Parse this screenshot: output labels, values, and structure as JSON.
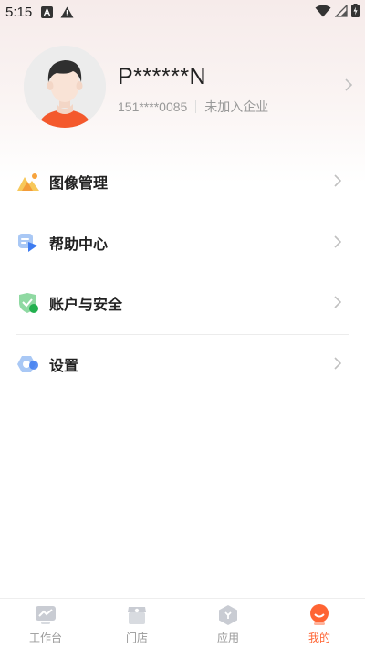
{
  "status_bar": {
    "time": "5:15",
    "icons": [
      "app-notification-icon",
      "warning-icon",
      "wifi-icon",
      "signal-icon",
      "battery-charging-icon"
    ]
  },
  "profile": {
    "nickname": "P******N",
    "phone": "151****0085",
    "company": "未加入企业",
    "avatar": "default-avatar"
  },
  "menu": {
    "items": [
      {
        "label": "图像管理",
        "icon": "image-management-icon"
      },
      {
        "label": "帮助中心",
        "icon": "help-center-icon"
      },
      {
        "label": "账户与安全",
        "icon": "account-security-icon"
      },
      {
        "label": "设置",
        "icon": "settings-icon"
      }
    ]
  },
  "tab_bar": {
    "tabs": [
      {
        "label": "工作台",
        "icon": "workbench-icon",
        "active": false
      },
      {
        "label": "门店",
        "icon": "store-icon",
        "active": false
      },
      {
        "label": "应用",
        "icon": "apps-icon",
        "active": false
      },
      {
        "label": "我的",
        "icon": "mine-icon",
        "active": true
      }
    ]
  },
  "colors": {
    "accent": "#ff6433",
    "inactive_tab": "#999999",
    "header_bg": "#f6ebea"
  }
}
